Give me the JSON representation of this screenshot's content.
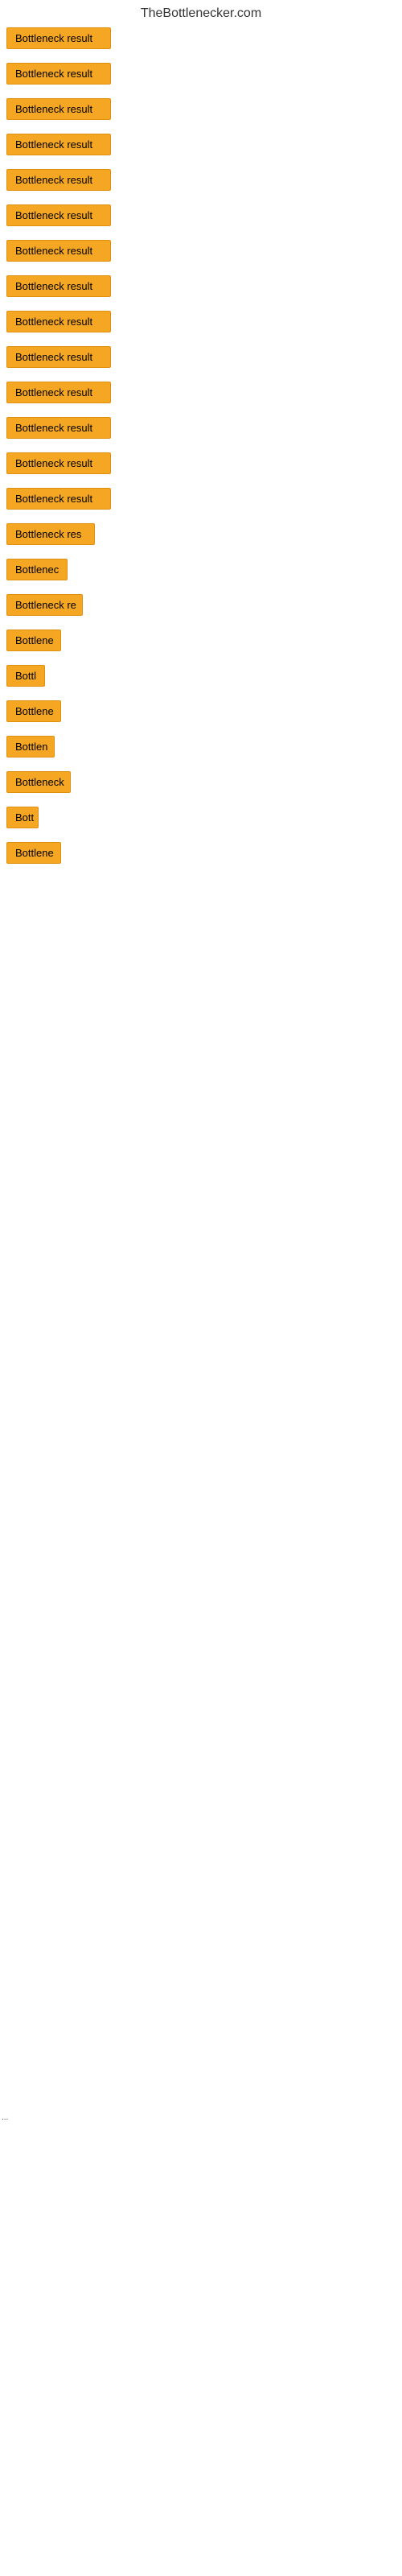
{
  "site": {
    "title": "TheBottlenecker.com"
  },
  "items": [
    {
      "label": "Bottleneck result",
      "width": 130
    },
    {
      "label": "Bottleneck result",
      "width": 130
    },
    {
      "label": "Bottleneck result",
      "width": 130
    },
    {
      "label": "Bottleneck result",
      "width": 130
    },
    {
      "label": "Bottleneck result",
      "width": 130
    },
    {
      "label": "Bottleneck result",
      "width": 130
    },
    {
      "label": "Bottleneck result",
      "width": 130
    },
    {
      "label": "Bottleneck result",
      "width": 130
    },
    {
      "label": "Bottleneck result",
      "width": 130
    },
    {
      "label": "Bottleneck result",
      "width": 130
    },
    {
      "label": "Bottleneck result",
      "width": 130
    },
    {
      "label": "Bottleneck result",
      "width": 130
    },
    {
      "label": "Bottleneck result",
      "width": 130
    },
    {
      "label": "Bottleneck result",
      "width": 130
    },
    {
      "label": "Bottleneck res",
      "width": 110
    },
    {
      "label": "Bottlenec",
      "width": 76
    },
    {
      "label": "Bottleneck re",
      "width": 95
    },
    {
      "label": "Bottlene",
      "width": 68
    },
    {
      "label": "Bottl",
      "width": 48
    },
    {
      "label": "Bottlene",
      "width": 68
    },
    {
      "label": "Bottlen",
      "width": 60
    },
    {
      "label": "Bottleneck",
      "width": 80
    },
    {
      "label": "Bott",
      "width": 40
    },
    {
      "label": "Bottlene",
      "width": 68
    }
  ],
  "dot": {
    "text": "..."
  }
}
